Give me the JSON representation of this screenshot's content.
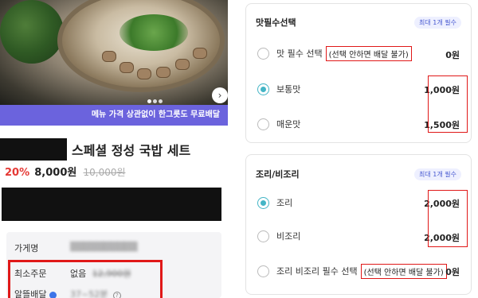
{
  "product": {
    "promo_banner": "메뉴 가격 상관없이 한그릇도 무료배달",
    "title": "스페셜 정성 국밥 세트",
    "discount": "20%",
    "price": "8,000원",
    "original_price": "10,000원"
  },
  "store_info": {
    "store_label": "가게명",
    "store_value": "▒▒▒▒▒▒▒▒▒▒",
    "min_order_label": "최소주문",
    "min_order_value": "없음",
    "min_order_struck": "12,900원",
    "delivery_label": "알뜰배달",
    "delivery_value": "37~52분",
    "icons": [
      "info-icon",
      "question-icon"
    ]
  },
  "taste_section": {
    "title": "맛필수선택",
    "badge": "최대 1개 필수",
    "options": [
      {
        "label": "맛 필수 선택",
        "note": "(선택 안하면 배달 불가)",
        "price": "0원",
        "selected": false
      },
      {
        "label": "보통맛",
        "note": "",
        "price": "1,000원",
        "selected": true
      },
      {
        "label": "매운맛",
        "note": "",
        "price": "1,500원",
        "selected": false
      }
    ]
  },
  "cook_section": {
    "title": "조리/비조리",
    "badge": "최대 1개 필수",
    "options": [
      {
        "label": "조리",
        "note": "",
        "price": "2,000원",
        "selected": true
      },
      {
        "label": "비조리",
        "note": "",
        "price": "2,000원",
        "selected": false
      },
      {
        "label": "조리 비조리 필수 선택",
        "note": "(선택 안하면 배달 불가)",
        "price": "0원",
        "selected": false
      }
    ]
  },
  "colors": {
    "promo_bg": "#6b63dd",
    "discount": "#e53935",
    "radio_accent": "#44b5c6",
    "highlight_frame": "#e01818",
    "badge_text": "#4a5bd1"
  }
}
